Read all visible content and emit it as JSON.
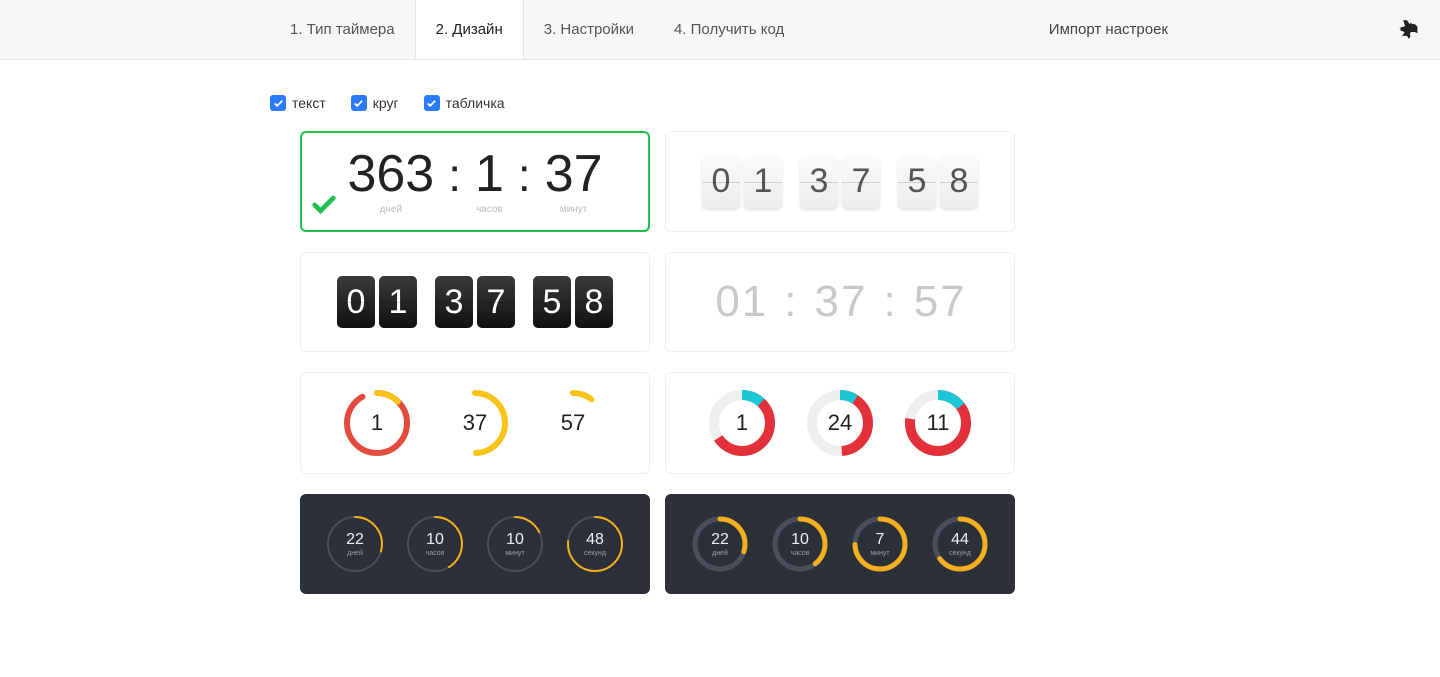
{
  "tabs": [
    {
      "label": "1. Тип таймера",
      "active": false
    },
    {
      "label": "2. Дизайн",
      "active": true
    },
    {
      "label": "3. Настройки",
      "active": false
    },
    {
      "label": "4. Получить код",
      "active": false
    }
  ],
  "import_label": "Импорт настроек",
  "filters": [
    {
      "label": "текст",
      "checked": true
    },
    {
      "label": "круг",
      "checked": true
    },
    {
      "label": "табличка",
      "checked": true
    }
  ],
  "style_text": {
    "selected": true,
    "days": "363",
    "days_l": "дней",
    "hours": "1",
    "hours_l": "часов",
    "mins": "37",
    "mins_l": "минут"
  },
  "style_flip_light": {
    "d1": "0",
    "d2": "1",
    "d3": "3",
    "d4": "7",
    "d5": "5",
    "d6": "8"
  },
  "style_flip_dark": {
    "d1": "0",
    "d2": "1",
    "d3": "3",
    "d4": "7",
    "d5": "5",
    "d6": "8"
  },
  "style_light_text": {
    "d1": "0",
    "d2": "1",
    "d3": "3",
    "d4": "7",
    "d5": "5",
    "d6": "7"
  },
  "style_circ_a": {
    "v1": "1",
    "v2": "37",
    "v3": "57"
  },
  "style_circ_b": {
    "v1": "1",
    "v2": "24",
    "v3": "11"
  },
  "style_dark_a": {
    "v1": "22",
    "v2": "10",
    "v3": "10",
    "v4": "48",
    "l1": "дней",
    "l2": "часов",
    "l3": "минут",
    "l4": "секунд"
  },
  "style_dark_b": {
    "v1": "22",
    "v2": "10",
    "v3": "7",
    "v4": "44",
    "l1": "дней",
    "l2": "часов",
    "l3": "минут",
    "l4": "секунд"
  }
}
